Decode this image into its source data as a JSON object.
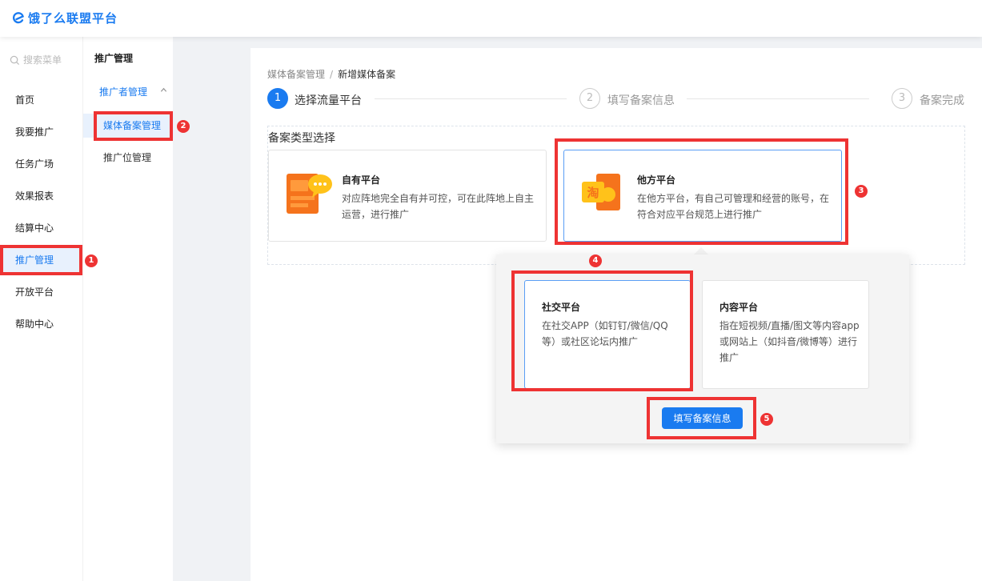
{
  "brand": {
    "name": "饿了么联盟平台",
    "color": "#1a7bf0"
  },
  "search": {
    "placeholder": "搜索菜单"
  },
  "sidebar": {
    "items": [
      {
        "label": "首页"
      },
      {
        "label": "我要推广"
      },
      {
        "label": "任务广场"
      },
      {
        "label": "效果报表"
      },
      {
        "label": "结算中心"
      },
      {
        "label": "推广管理"
      },
      {
        "label": "开放平台"
      },
      {
        "label": "帮助中心"
      }
    ],
    "active": "推广管理"
  },
  "subnav": {
    "title": "推广管理",
    "group": "推广者管理",
    "items": [
      {
        "label": "媒体备案管理"
      },
      {
        "label": "推广位管理"
      }
    ],
    "active": "媒体备案管理"
  },
  "breadcrumb": {
    "parent": "媒体备案管理",
    "separator": "/",
    "current": "新增媒体备案"
  },
  "steps": [
    {
      "num": "1",
      "label": "选择流量平台",
      "status": "active"
    },
    {
      "num": "2",
      "label": "填写备案信息",
      "status": "pending"
    },
    {
      "num": "3",
      "label": "备案完成",
      "status": "pending"
    }
  ],
  "section": {
    "title": "备案类型选择"
  },
  "cards": {
    "own": {
      "title": "自有平台",
      "desc": "对应阵地完全自有并可控，可在此阵地上自主运营，进行推广"
    },
    "third": {
      "title": "他方平台",
      "desc": "在他方平台，有自己可管理和经营的账号，在符合对应平台规范上进行推广",
      "icon_text": "淘"
    }
  },
  "popup": {
    "social": {
      "title": "社交平台",
      "desc": "在社交APP（如钉钉/微信/QQ等）或社区论坛内推广"
    },
    "content": {
      "title": "内容平台",
      "desc": "指在短视频/直播/图文等内容app或网站上（如抖音/微博等）进行推广"
    },
    "button": "填写备案信息"
  },
  "annotations": [
    "1",
    "2",
    "3",
    "4",
    "5"
  ],
  "colors": {
    "accent": "#1a7bf0",
    "highlight": "#ee3333",
    "active_bg": "#e8f1fd"
  }
}
